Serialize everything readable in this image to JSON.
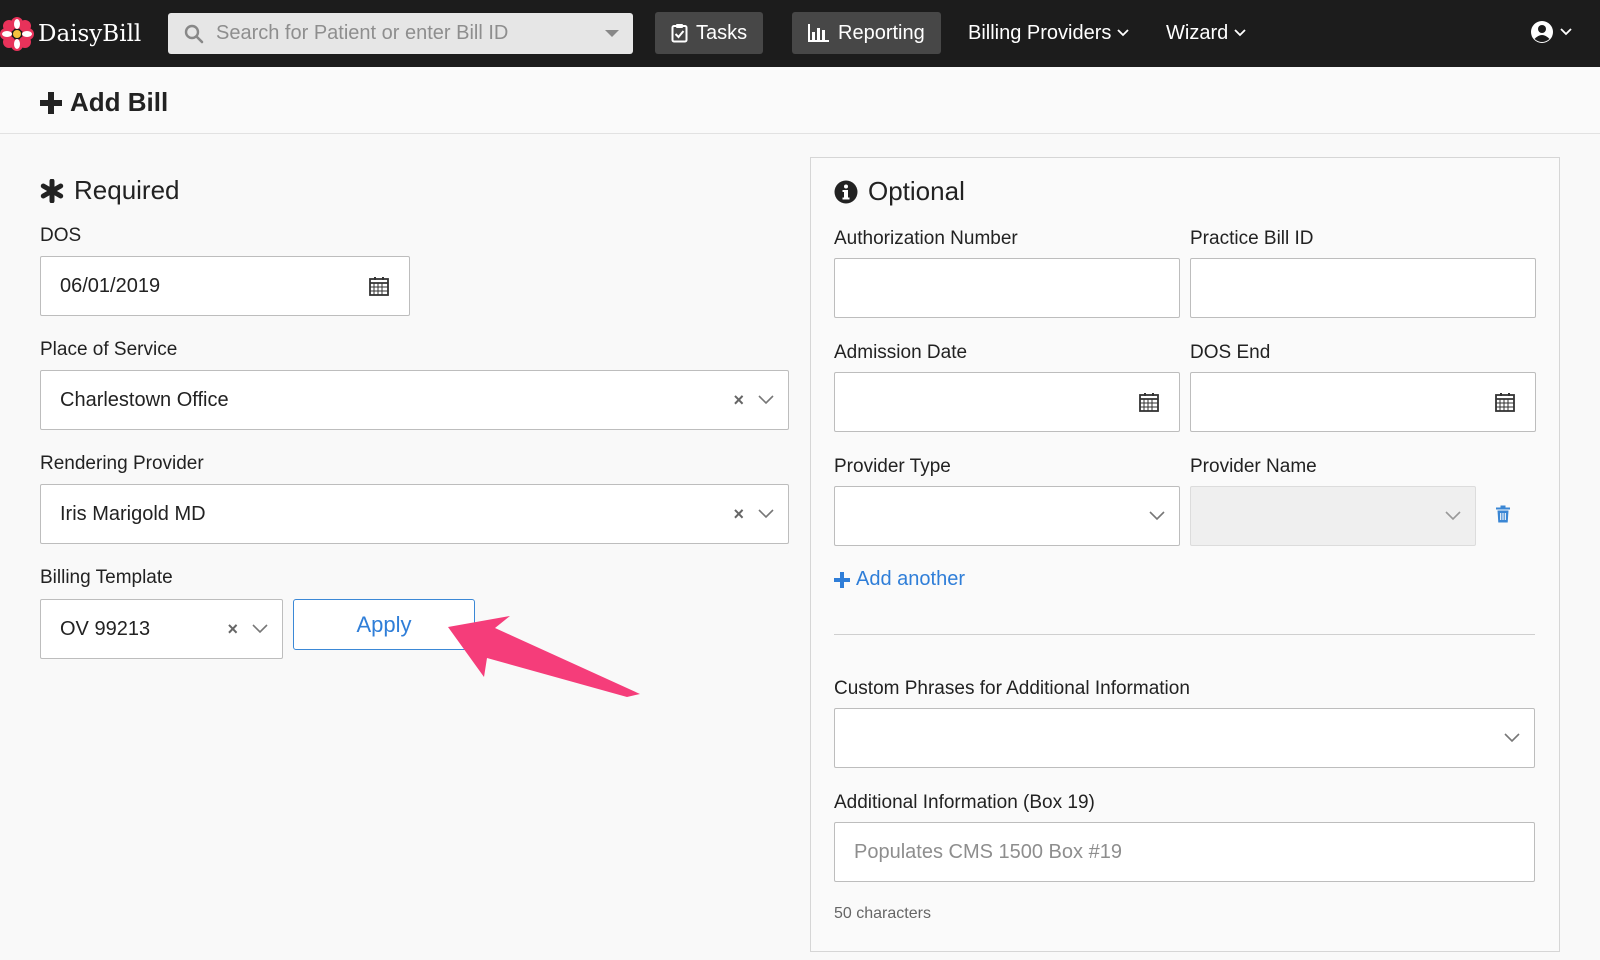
{
  "nav": {
    "brand": "DaisyBill",
    "search_placeholder": "Search for Patient or enter Bill ID",
    "tasks": "Tasks",
    "reporting": "Reporting",
    "billing_providers": "Billing Providers",
    "wizard": "Wizard"
  },
  "header": {
    "title": "Add Bill"
  },
  "required": {
    "title": "Required",
    "dos_label": "DOS",
    "dos_value": "06/01/2019",
    "place_label": "Place of Service",
    "place_value": "Charlestown Office",
    "provider_label": "Rendering Provider",
    "provider_value": "Iris Marigold MD",
    "template_label": "Billing Template",
    "template_value": "OV 99213",
    "apply": "Apply"
  },
  "optional": {
    "title": "Optional",
    "auth_label": "Authorization Number",
    "bill_id_label": "Practice Bill ID",
    "admission_label": "Admission Date",
    "dos_end_label": "DOS End",
    "provider_type_label": "Provider Type",
    "provider_name_label": "Provider Name",
    "add_another": "Add another",
    "custom_phrases_label": "Custom Phrases for Additional Information",
    "additional_label": "Additional Information (Box 19)",
    "additional_placeholder": "Populates CMS 1500 Box #19",
    "char_hint": "50 characters"
  },
  "colors": {
    "nav_bg": "#1c1c1c",
    "link_blue": "#2f7ed8",
    "arrow_pink": "#f53d7a"
  }
}
